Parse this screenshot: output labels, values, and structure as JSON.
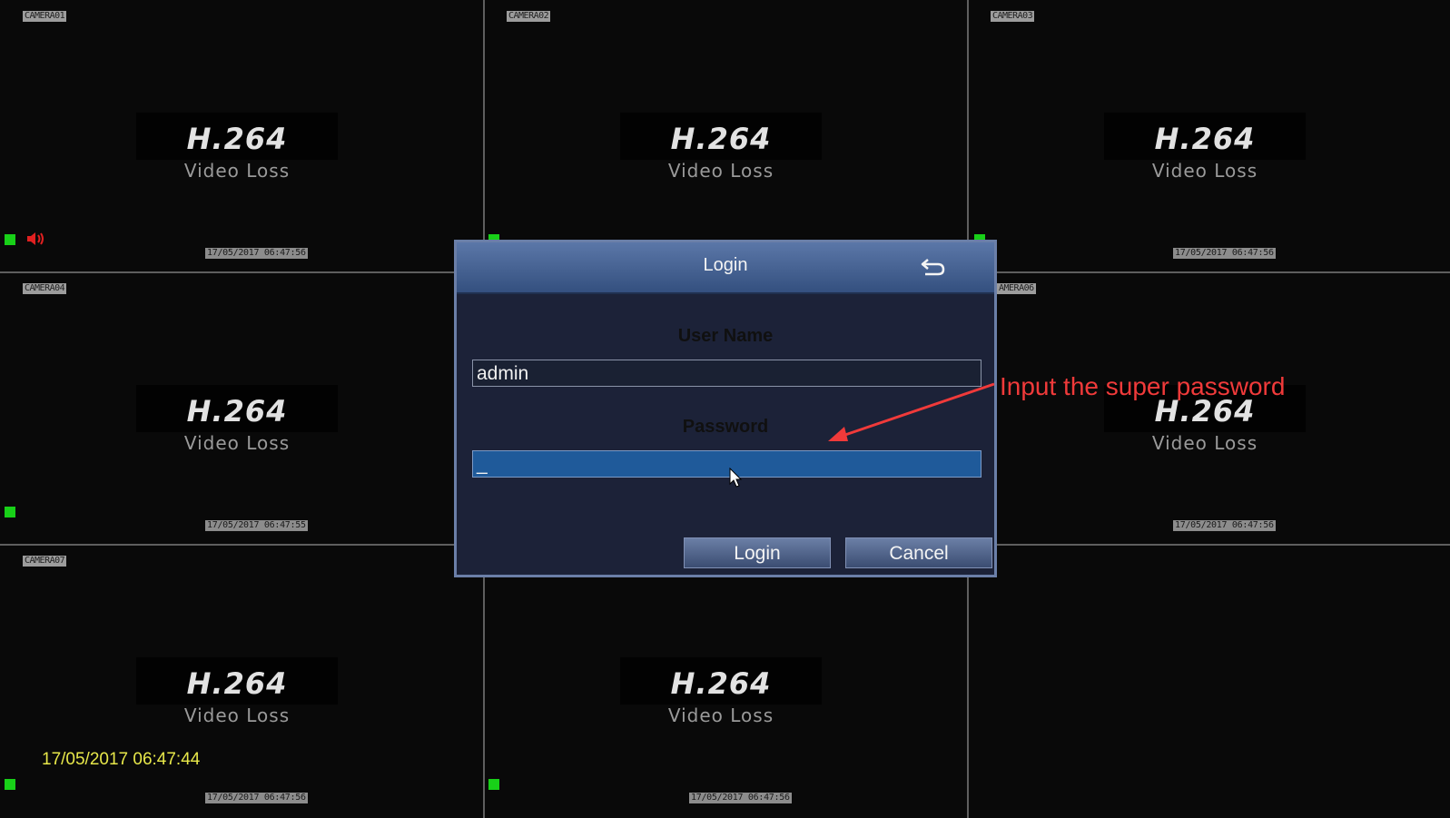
{
  "cameras": [
    {
      "name": "CAMERA01",
      "codec": "H.264",
      "status": "Video Loss",
      "timestamp": "17/05/2017 06:47:56"
    },
    {
      "name": "CAMERA02",
      "codec": "H.264",
      "status": "Video Loss",
      "timestamp": ""
    },
    {
      "name": "CAMERA03",
      "codec": "H.264",
      "status": "Video Loss",
      "timestamp": "17/05/2017 06:47:56"
    },
    {
      "name": "CAMERA04",
      "codec": "H.264",
      "status": "Video Loss",
      "timestamp": "17/05/2017 06:47:55"
    },
    {
      "name": "",
      "codec": "",
      "status": "",
      "timestamp": ""
    },
    {
      "name": "AMERA06",
      "codec": "H.264",
      "status": "Video Loss",
      "timestamp": "17/05/2017 06:47:56"
    },
    {
      "name": "CAMERA07",
      "codec": "H.264",
      "status": "Video Loss",
      "timestamp": "17/05/2017 06:47:56"
    },
    {
      "name": "",
      "codec": "H.264",
      "status": "Video Loss",
      "timestamp": "17/05/2017 06:47:56"
    },
    {
      "name": "",
      "codec": "",
      "status": "",
      "timestamp": ""
    }
  ],
  "system_time": "17/05/2017 06:47:44",
  "dialog": {
    "title": "Login",
    "back_icon": "return-arrow-icon",
    "username_label": "User Name",
    "username_value": "admin",
    "password_label": "Password",
    "password_value": "_",
    "login_button": "Login",
    "cancel_button": "Cancel"
  },
  "annotation": {
    "text": "Input the super password",
    "color": "#f03a3a"
  },
  "colors": {
    "record_indicator": "#18d018",
    "audio_icon": "#e02020",
    "system_time": "#e8e84a"
  }
}
